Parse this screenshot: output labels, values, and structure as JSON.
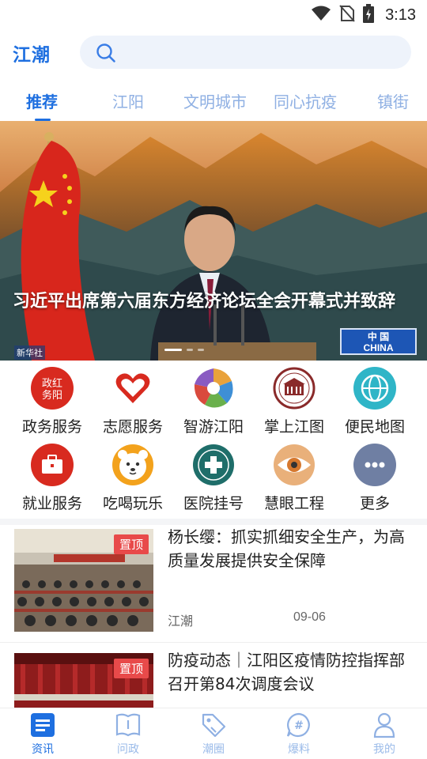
{
  "status_bar": {
    "time": "3:13"
  },
  "header": {
    "logo": "江潮",
    "search_placeholder": ""
  },
  "tabs": [
    {
      "label": "推荐",
      "active": true
    },
    {
      "label": "江阳",
      "active": false
    },
    {
      "label": "文明城市",
      "active": false
    },
    {
      "label": "同心抗疫",
      "active": false
    },
    {
      "label": "镇街",
      "active": false
    }
  ],
  "banner": {
    "caption": "习近平出席第六届东方经济论坛全会开幕式并致辞",
    "watermark": "新华社",
    "plate_cn": "中 国",
    "plate_en": "CHINA"
  },
  "services": [
    {
      "label": "政务服务",
      "icon": "government-service-icon"
    },
    {
      "label": "志愿服务",
      "icon": "volunteer-heart-icon"
    },
    {
      "label": "智游江阳",
      "icon": "smart-travel-icon"
    },
    {
      "label": "掌上江图",
      "icon": "library-building-icon"
    },
    {
      "label": "便民地图",
      "icon": "globe-map-icon"
    },
    {
      "label": "就业服务",
      "icon": "briefcase-icon"
    },
    {
      "label": "吃喝玩乐",
      "icon": "bear-face-icon"
    },
    {
      "label": "医院挂号",
      "icon": "hospital-badge-icon"
    },
    {
      "label": "慧眼工程",
      "icon": "eye-icon"
    },
    {
      "label": "更多",
      "icon": "more-dots-icon"
    }
  ],
  "news": [
    {
      "title": "杨长缨：抓实抓细安全生产，为高质量发展提供安全保障",
      "badge": "置顶",
      "source": "江潮",
      "date": "09-06"
    },
    {
      "title": "防疫动态｜江阳区疫情防控指挥部召开第84次调度会议",
      "badge": "置顶",
      "source": "",
      "date": ""
    }
  ],
  "bottom_nav": [
    {
      "label": "资讯",
      "active": true
    },
    {
      "label": "问政",
      "active": false
    },
    {
      "label": "潮圈",
      "active": false
    },
    {
      "label": "爆料",
      "active": false
    },
    {
      "label": "我的",
      "active": false
    }
  ],
  "colors": {
    "accent": "#1e6fe0",
    "pin": "#e84a4a"
  }
}
